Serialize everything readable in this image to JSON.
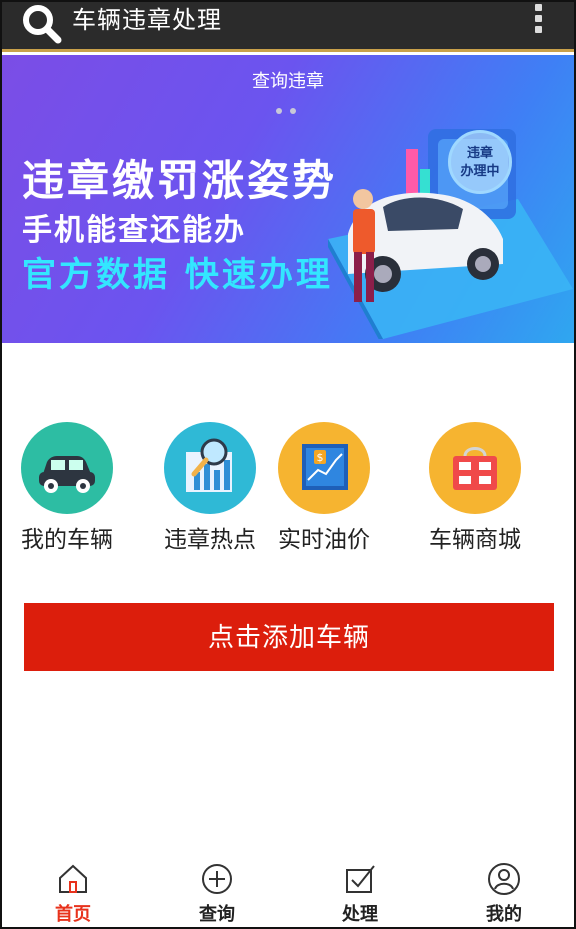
{
  "app": {
    "title": "车辆违章处理"
  },
  "topbar": {
    "search_icon": "search-icon",
    "menu_icon": "more-vertical-icon"
  },
  "banner": {
    "caption": "查询违章",
    "headline": "违章缴罚涨姿势",
    "subline": "手机能查还能办",
    "tagline": "官方数据 快速办理",
    "badge_text": "违章\n办理中",
    "badge_line1": "违章",
    "badge_line2": "办理中",
    "dot_count": 2
  },
  "grid": [
    {
      "label": "我的车辆",
      "icon": "car-icon",
      "color": "#2dbda3"
    },
    {
      "label": "违章热点",
      "icon": "magnifier-chart-icon",
      "color": "#2fb9d6"
    },
    {
      "label": "实时油价",
      "icon": "price-chart-icon",
      "color": "#f6b430"
    },
    {
      "label": "车辆商城",
      "icon": "shopping-bag-icon",
      "color": "#f6b430"
    }
  ],
  "add_button": {
    "label": "点击添加车辆",
    "color": "#dc1e0c"
  },
  "bottom_nav": [
    {
      "label": "首页",
      "icon": "home-icon",
      "active": true
    },
    {
      "label": "查询",
      "icon": "query-icon",
      "active": false
    },
    {
      "label": "处理",
      "icon": "checkbox-icon",
      "active": false
    },
    {
      "label": "我的",
      "icon": "user-icon",
      "active": false
    }
  ],
  "colors": {
    "topbar": "#2b2b2b",
    "accent_red": "#e8321c",
    "banner_start": "#7b4de6",
    "banner_end": "#2fa7f0"
  }
}
